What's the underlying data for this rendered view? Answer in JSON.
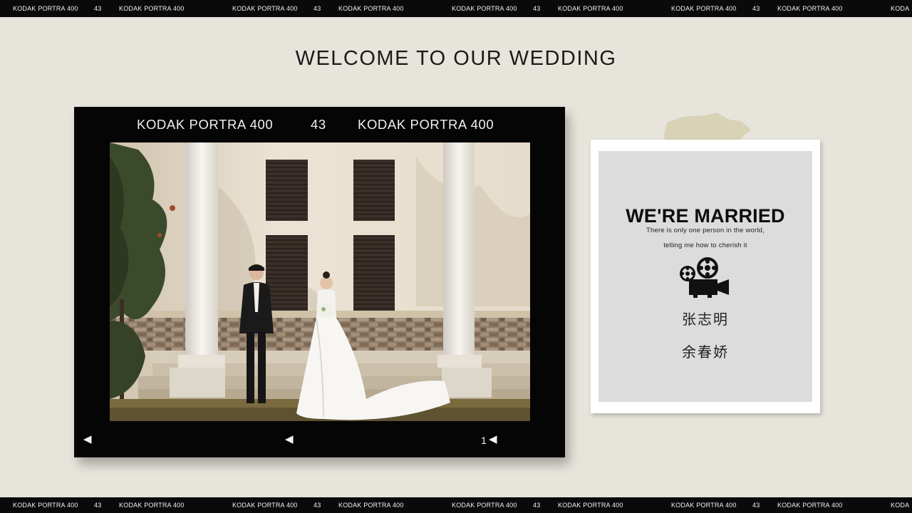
{
  "strip": {
    "brand": "KODAK PORTRA 400",
    "number": "43",
    "brand_end": "KODA"
  },
  "page": {
    "title": "WELCOME TO OUR WEDDING"
  },
  "film": {
    "label_left": "KODAK PORTRA 400",
    "number": "43",
    "label_right": "KODAK PORTRA 400",
    "frame_number": "1",
    "arrow_icon": "triangle-left-icon"
  },
  "card": {
    "title": "WE'RE MARRIED",
    "line1": "There is only one person in the world,",
    "line2": "telling me how to cherish it",
    "icon": "film-camera-icon",
    "groom": "张志明",
    "bride": "余春娇"
  },
  "colors": {
    "background": "#e7e4dc",
    "film": "#050505",
    "tape": "#d8d2b6",
    "card_inner": "#dcdcdc"
  }
}
